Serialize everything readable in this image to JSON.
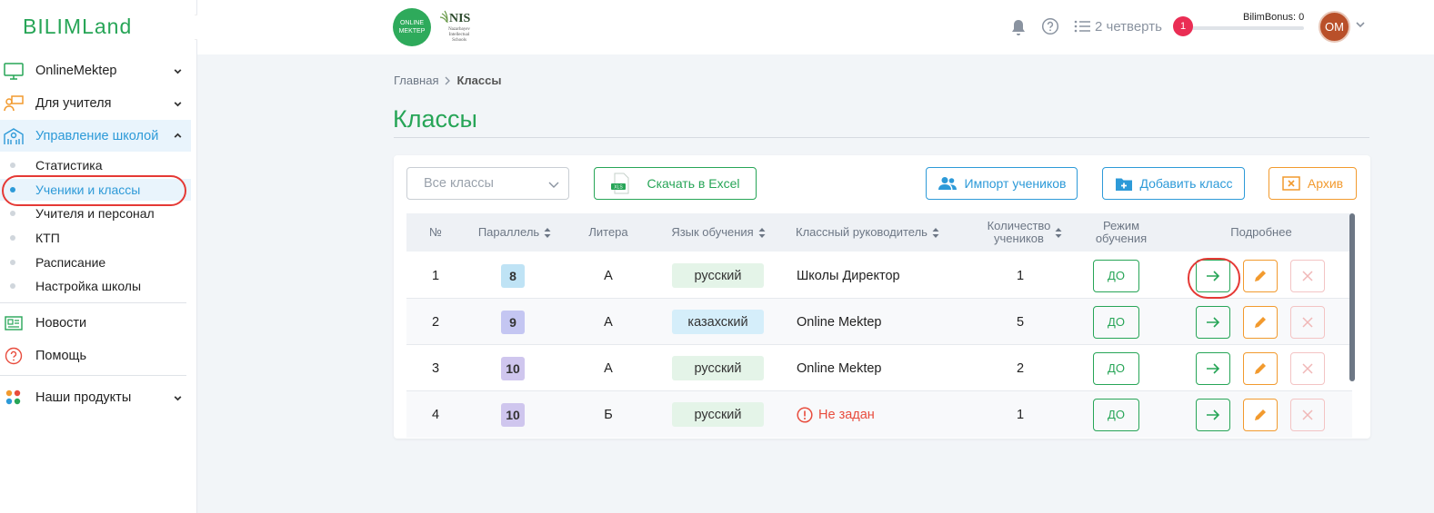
{
  "brand": {
    "logo_text": "BILIMLand"
  },
  "sidebar": {
    "items": [
      {
        "label": "OnlineMektep",
        "icon": "monitor-icon"
      },
      {
        "label": "Для учителя",
        "icon": "teacher-icon"
      },
      {
        "label": "Управление школой",
        "icon": "school-icon"
      },
      {
        "label": "Новости",
        "icon": "news-icon"
      },
      {
        "label": "Помощь",
        "icon": "help-icon"
      },
      {
        "label": "Наши продукты",
        "icon": "products-icon"
      }
    ],
    "sub_items": [
      {
        "label": "Статистика"
      },
      {
        "label": "Ученики и классы"
      },
      {
        "label": "Учителя и персонал"
      },
      {
        "label": "КТП"
      },
      {
        "label": "Расписание"
      },
      {
        "label": "Настройка школы"
      }
    ]
  },
  "header": {
    "om_logo": "ONLINE MEKTEP",
    "nis_logo": "NIS",
    "nis_sub": "Nazarbayev Intellectual Schools",
    "quarter": "2 четверть",
    "bonus_label": "BilimBonus: 0",
    "bonus_level": 1,
    "avatar": "OM"
  },
  "breadcrumb": {
    "home": "Главная",
    "current": "Классы"
  },
  "page_title": "Классы",
  "toolbar": {
    "select_placeholder": "Все классы",
    "excel_label": "Скачать в Excel",
    "excel_icon_text": "XLS",
    "import_label": "Импорт учеников",
    "add_label": "Добавить класс",
    "archive_label": "Архив"
  },
  "table": {
    "headers": {
      "num": "№",
      "parallel": "Параллель",
      "litera": "Литера",
      "language": "Язык обучения",
      "teacher": "Классный руководитель",
      "count_1": "Количество",
      "count_2": "учеников",
      "mode_1": "Режим",
      "mode_2": "обучения",
      "details": "Подробнее"
    },
    "rows": [
      {
        "num": "1",
        "parallel": "8",
        "litera": "А",
        "language": "русский",
        "teacher": "Школы Директор",
        "count": "1",
        "mode": "ДО"
      },
      {
        "num": "2",
        "parallel": "9",
        "litera": "А",
        "language": "казахский",
        "teacher": "Online Mektep",
        "count": "5",
        "mode": "ДО"
      },
      {
        "num": "3",
        "parallel": "10",
        "litera": "А",
        "language": "русский",
        "teacher": "Online Mektep",
        "count": "2",
        "mode": "ДО"
      },
      {
        "num": "4",
        "parallel": "10",
        "litera": "Б",
        "language": "русский",
        "teacher": "Не задан",
        "count": "1",
        "mode": "ДО"
      }
    ]
  },
  "colors": {
    "green": "#27a557",
    "blue": "#2d9ad8",
    "orange": "#f29a2e",
    "red": "#e53935",
    "badge_8": "#bfe3f5",
    "badge_9": "#c4c6f2",
    "badge_10": "#cfc6ee",
    "lang_ru": "#e4f4e8",
    "lang_kz": "#d5eefa"
  }
}
